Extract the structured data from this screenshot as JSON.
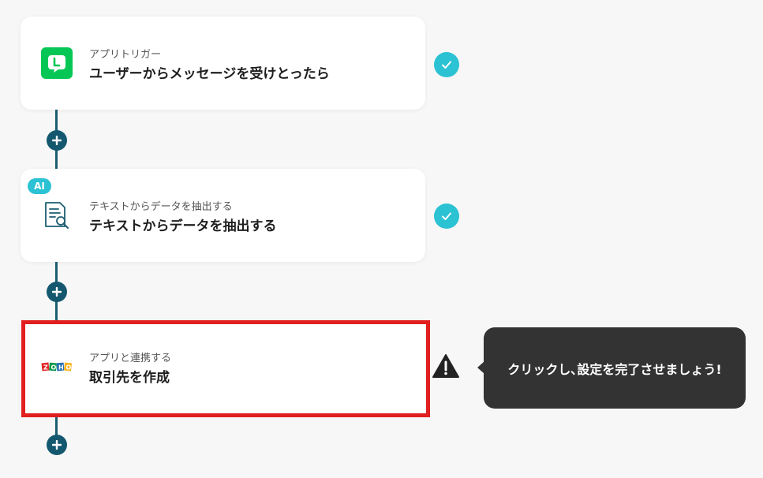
{
  "flow": {
    "steps": [
      {
        "subtitle": "アプリトリガー",
        "title": "ユーザーからメッセージを受けとったら",
        "icon": "line-app-icon",
        "status": "completed"
      },
      {
        "badge": "AI",
        "subtitle": "テキストからデータを抽出する",
        "title": "テキストからデータを抽出する",
        "icon": "document-search-icon",
        "status": "completed"
      },
      {
        "subtitle": "アプリと連携する",
        "title": "取引先を作成",
        "icon": "zoho-logo-icon",
        "logo_text": "ZOHO",
        "status": "incomplete"
      }
    ]
  },
  "tooltip": {
    "text": "クリックし､設定を完了させましょう!"
  },
  "colors": {
    "connector": "#1d5f72",
    "plus_button": "#14586f",
    "check": "#2bc2d3",
    "line_green": "#06c755",
    "highlight": "#e11f1f",
    "tooltip_bg": "#333333",
    "zoho_red": "#e42527",
    "zoho_green": "#089949",
    "zoho_blue": "#226db4",
    "zoho_yellow": "#f9b21d"
  }
}
